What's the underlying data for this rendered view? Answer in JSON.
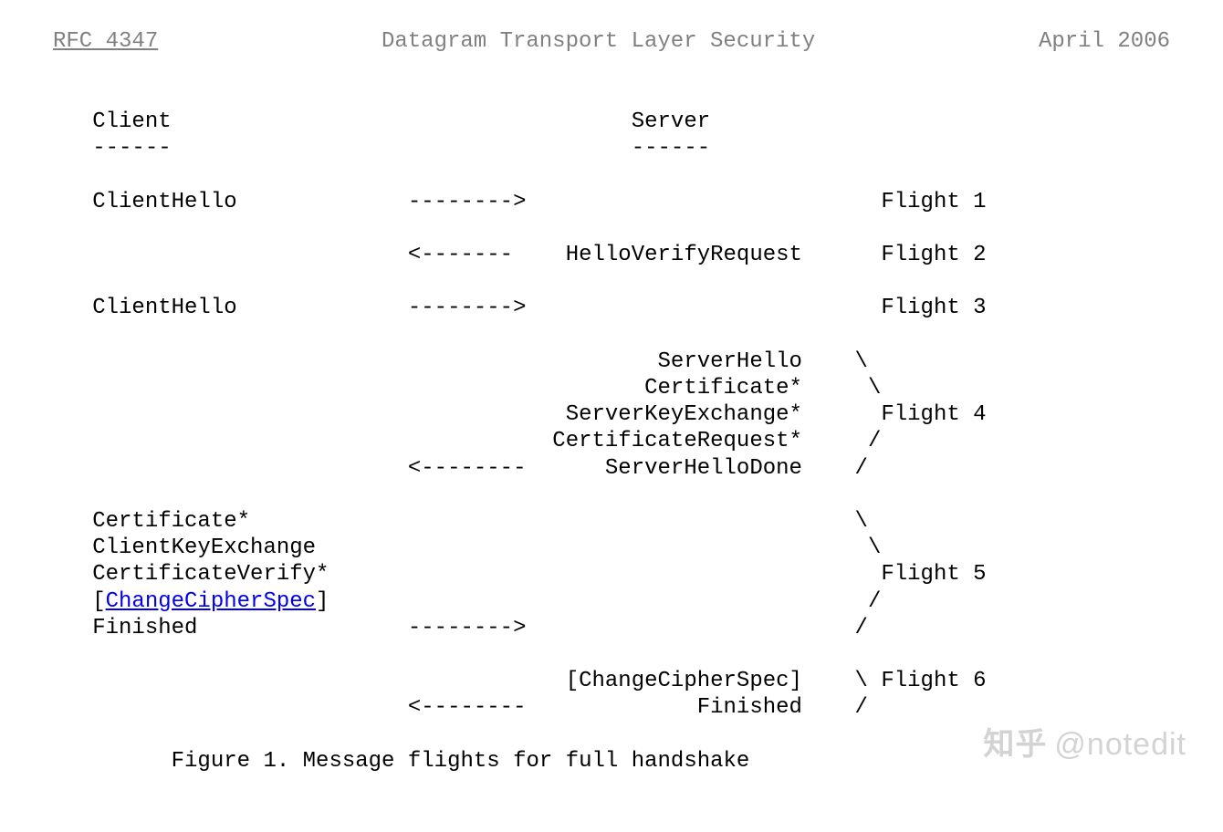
{
  "header": {
    "rfc": "RFC 4347",
    "title": "Datagram Transport Layer Security",
    "date": "April 2006"
  },
  "diagram": {
    "l01": "   Client                                   Server",
    "l02": "   ------                                   ------",
    "l03": "",
    "l04": "   ClientHello             -------->                           Flight 1",
    "l05": "",
    "l06": "                           <-------    HelloVerifyRequest      Flight 2",
    "l07": "",
    "l08": "   ClientHello             -------->                           Flight 3",
    "l09": "",
    "l10": "                                              ServerHello    \\",
    "l11": "                                             Certificate*     \\",
    "l12": "                                       ServerKeyExchange*      Flight 4",
    "l13": "                                      CertificateRequest*     /",
    "l14": "                           <--------      ServerHelloDone    /",
    "l15": "",
    "l16": "   Certificate*                                              \\",
    "l17": "   ClientKeyExchange                                          \\",
    "l18": "   CertificateVerify*                                          Flight 5",
    "l19a": "   [",
    "l19link": "ChangeCipherSpec",
    "l19b": "]                                         /",
    "l20": "   Finished                -------->                         /",
    "l21": "",
    "l22": "                                       [ChangeCipherSpec]    \\ Flight 6",
    "l23": "                           <--------             Finished    /",
    "caption": "         Figure 1. Message flights for full handshake"
  },
  "watermark": {
    "brand": "知乎",
    "user": "@notedit"
  }
}
